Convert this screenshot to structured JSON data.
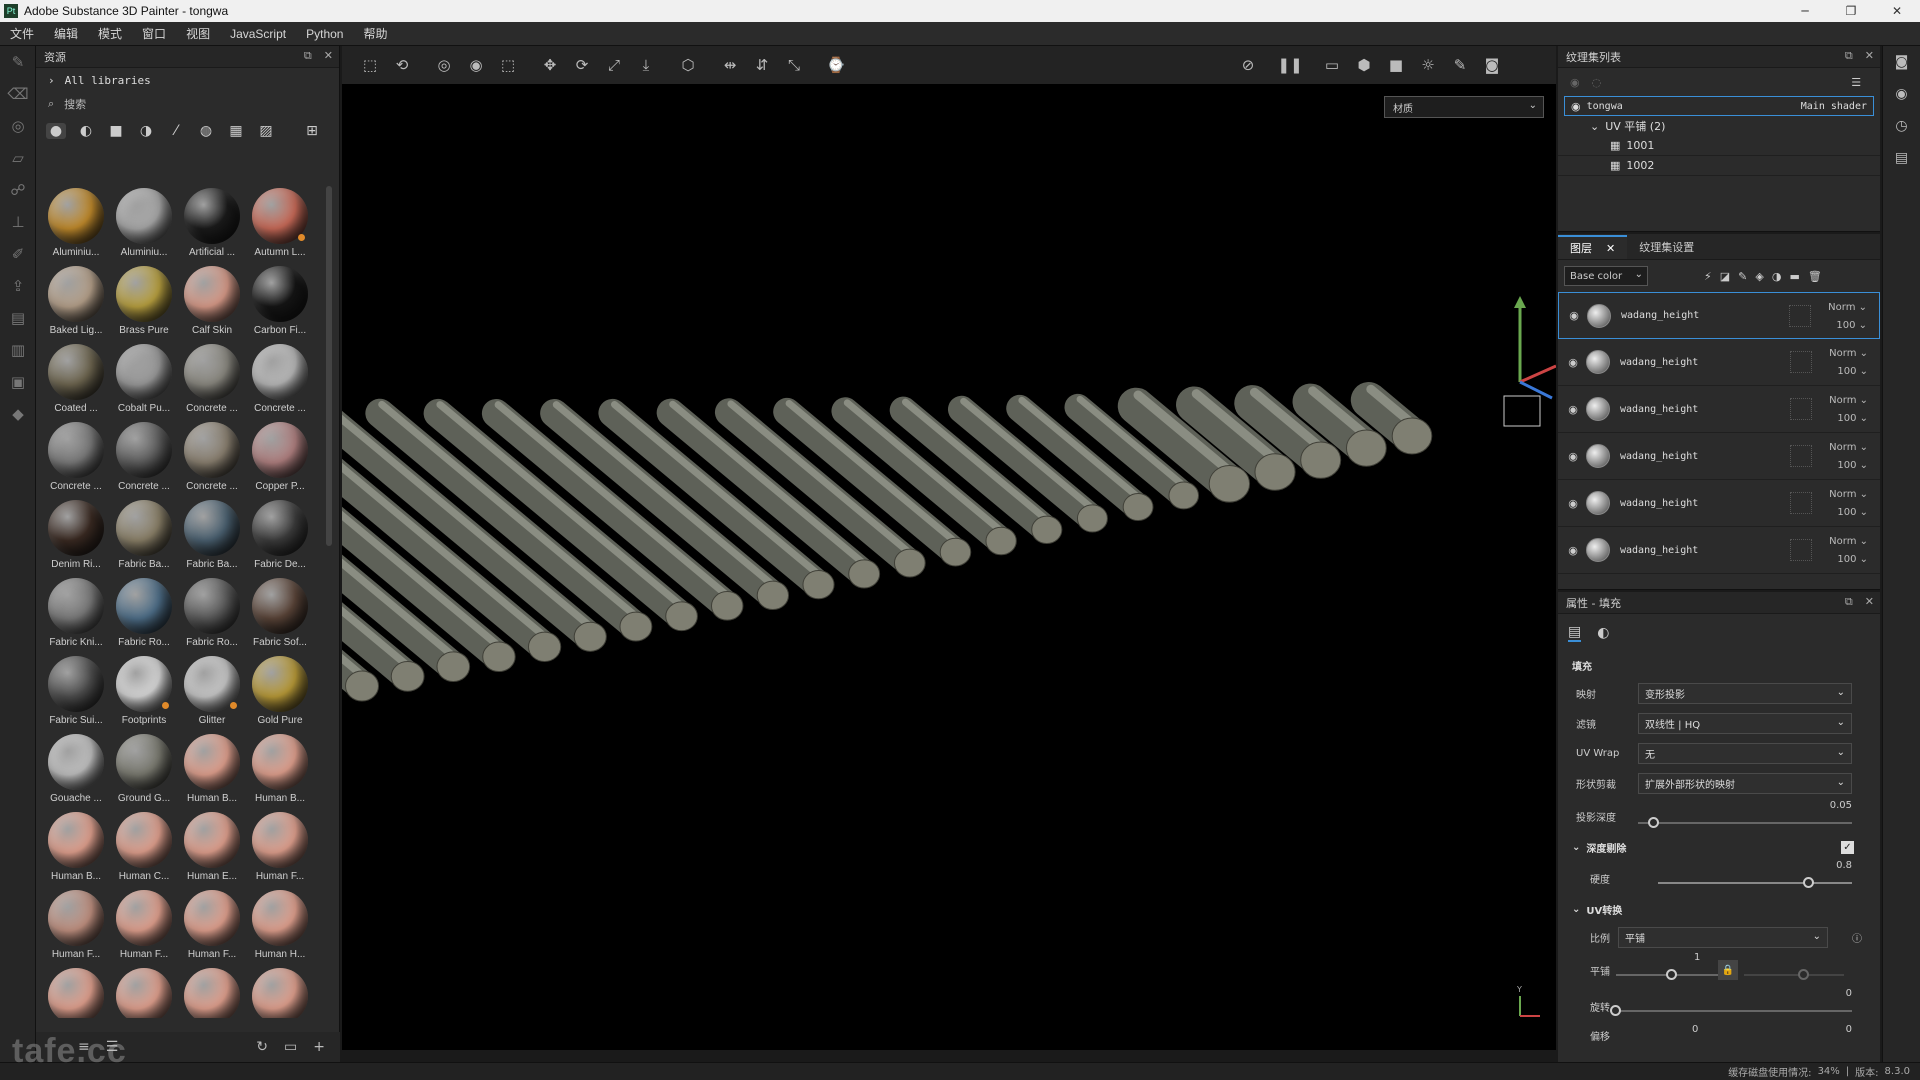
{
  "window": {
    "title": "Adobe Substance 3D Painter - tongwa",
    "app_icon": "Pt",
    "controls": [
      "─",
      "❐",
      "✕"
    ]
  },
  "menu": [
    "文件",
    "编辑",
    "模式",
    "窗口",
    "视图",
    "JavaScript",
    "Python",
    "帮助"
  ],
  "assets": {
    "title": "资源",
    "library": "All libraries",
    "search_placeholder": "搜索",
    "items": [
      {
        "label": "Aluminiu...",
        "color": "#c08a2c",
        "dot": false
      },
      {
        "label": "Aluminiu...",
        "color": "#a8a8a8",
        "dot": false
      },
      {
        "label": "Artificial ...",
        "color": "#1b1b1b",
        "dot": false
      },
      {
        "label": "Autumn L...",
        "color": "#c86a58",
        "dot": true
      },
      {
        "label": "Baked Lig...",
        "color": "#b5a08a",
        "dot": false
      },
      {
        "label": "Brass Pure",
        "color": "#b8a040",
        "dot": false
      },
      {
        "label": "Calf Skin",
        "color": "#d79a88",
        "dot": false
      },
      {
        "label": "Carbon Fi...",
        "color": "#151515",
        "dot": false
      },
      {
        "label": "Coated ...",
        "color": "#6e6650",
        "dot": false
      },
      {
        "label": "Cobalt Pu...",
        "color": "#9a9a9a",
        "dot": false
      },
      {
        "label": "Concrete ...",
        "color": "#8a8880",
        "dot": false
      },
      {
        "label": "Concrete ...",
        "color": "#b8b8b8",
        "dot": false
      },
      {
        "label": "Concrete ...",
        "color": "#7a7a7a",
        "dot": false
      },
      {
        "label": "Concrete ...",
        "color": "#5e5e5e",
        "dot": false
      },
      {
        "label": "Concrete ...",
        "color": "#8a8070",
        "dot": false
      },
      {
        "label": "Copper P...",
        "color": "#b08080",
        "dot": false
      },
      {
        "label": "Denim Ri...",
        "color": "#3a2a22",
        "dot": false
      },
      {
        "label": "Fabric Ba...",
        "color": "#8a8068",
        "dot": false
      },
      {
        "label": "Fabric Ba...",
        "color": "#4a6070",
        "dot": false
      },
      {
        "label": "Fabric De...",
        "color": "#3c3c3c",
        "dot": false
      },
      {
        "label": "Fabric Kni...",
        "color": "#7a7a7a",
        "dot": false
      },
      {
        "label": "Fabric Ro...",
        "color": "#4e6e88",
        "dot": false
      },
      {
        "label": "Fabric Ro...",
        "color": "#5a5a5a",
        "dot": false
      },
      {
        "label": "Fabric Sof...",
        "color": "#5a4438",
        "dot": false
      },
      {
        "label": "Fabric Sui...",
        "color": "#4e4e4e",
        "dot": false
      },
      {
        "label": "Footprints",
        "color": "#d8d8d8",
        "dot": true
      },
      {
        "label": "Glitter",
        "color": "#c8c8c8",
        "dot": true
      },
      {
        "label": "Gold Pure",
        "color": "#b89a38",
        "dot": false
      },
      {
        "label": "Gouache ...",
        "color": "#c0c0c0",
        "dot": false
      },
      {
        "label": "Ground G...",
        "color": "#7a7a70",
        "dot": false
      },
      {
        "label": "Human B...",
        "color": "#e0a08e",
        "dot": false
      },
      {
        "label": "Human B...",
        "color": "#e0a08e",
        "dot": false
      },
      {
        "label": "Human B...",
        "color": "#e0a08e",
        "dot": false
      },
      {
        "label": "Human C...",
        "color": "#e0a08e",
        "dot": false
      },
      {
        "label": "Human E...",
        "color": "#e0a08e",
        "dot": false
      },
      {
        "label": "Human F...",
        "color": "#e0a08e",
        "dot": false
      },
      {
        "label": "Human F...",
        "color": "#c09080",
        "dot": false
      },
      {
        "label": "Human F...",
        "color": "#e0a08e",
        "dot": false
      },
      {
        "label": "Human F...",
        "color": "#e0a08e",
        "dot": false
      },
      {
        "label": "Human H...",
        "color": "#e0a08e",
        "dot": false
      },
      {
        "label": "",
        "color": "#e0a08e",
        "dot": false
      },
      {
        "label": "",
        "color": "#e0a08e",
        "dot": false
      },
      {
        "label": "",
        "color": "#e0a08e",
        "dot": false
      },
      {
        "label": "",
        "color": "#e0a08e",
        "dot": false
      }
    ]
  },
  "viewport": {
    "material_mode": "材质"
  },
  "texture_set_list": {
    "title": "纹理集列表",
    "set_name": "tongwa",
    "shader": "Main shader",
    "uv_label": "UV 平铺 (2)",
    "tiles": [
      "1001",
      "1002"
    ]
  },
  "layers_panel": {
    "tabs": [
      "图层",
      "纹理集设置"
    ],
    "channel": "Base color",
    "layers": [
      {
        "name": "wadang_height",
        "blend": "Norm",
        "opacity": "100"
      },
      {
        "name": "wadang_height",
        "blend": "Norm",
        "opacity": "100"
      },
      {
        "name": "wadang_height",
        "blend": "Norm",
        "opacity": "100"
      },
      {
        "name": "wadang_height",
        "blend": "Norm",
        "opacity": "100"
      },
      {
        "name": "wadang_height",
        "blend": "Norm",
        "opacity": "100"
      },
      {
        "name": "wadang_height",
        "blend": "Norm",
        "opacity": "100"
      }
    ]
  },
  "properties": {
    "title": "属性 - 填充",
    "section_fill": "填充",
    "projection_label": "映射",
    "projection_value": "变形投影",
    "filter_label": "滤镜",
    "filter_value": "双线性 | HQ",
    "uvwrap_label": "UV Wrap",
    "uvwrap_value": "无",
    "shape_label": "形状剪裁",
    "shape_value": "扩展外部形状的映射",
    "depth_label": "投影深度",
    "depth_value": "0.05",
    "occlusion_section": "深度剔除",
    "hardness_label": "硬度",
    "hardness_value": "0.8",
    "uv_section": "UV转换",
    "scale_label": "比例",
    "scale_value": "平铺",
    "tile_label": "平铺",
    "tile_value": "1",
    "rotate_label": "旋转",
    "rotate_value": "0",
    "offset_label": "偏移",
    "offset_x": "0",
    "offset_y": "0"
  },
  "status": {
    "cache_label": "缓存磁盘使用情况:",
    "cache_value": "34%",
    "version_label": "版本:",
    "version_value": "8.3.0"
  },
  "watermark": "tafe.cc"
}
